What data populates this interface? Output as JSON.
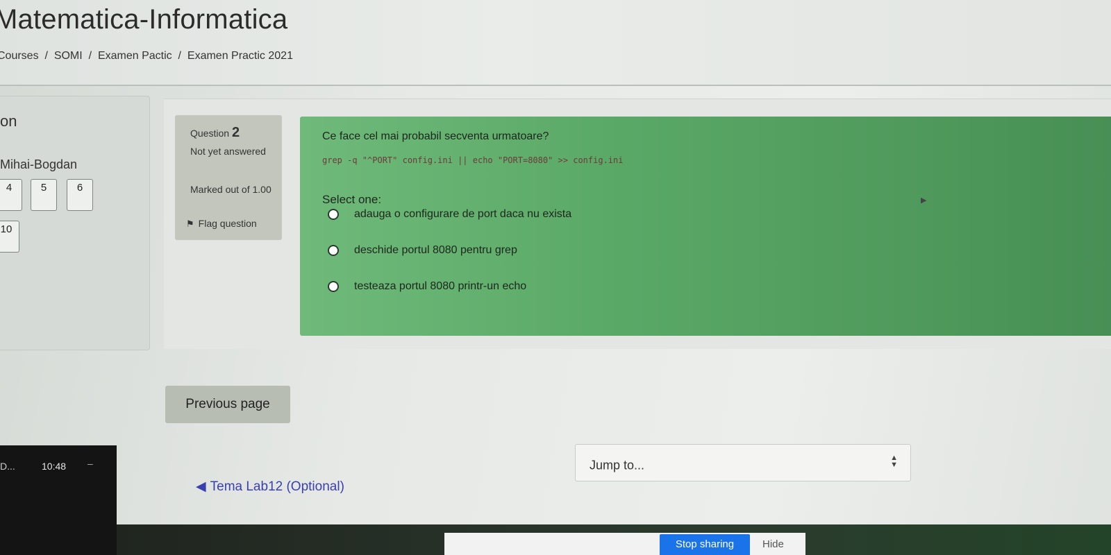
{
  "header": {
    "site_title": "Matematica-Informatica",
    "breadcrumb": [
      "Courses",
      "SOMI",
      "Examen Pactic",
      "Examen Practic 2021"
    ],
    "separator": "/"
  },
  "quiz_nav": {
    "heading": "on",
    "user": "Mihai-Bogdan",
    "buttons": [
      "4",
      "5",
      "6",
      "10"
    ]
  },
  "question_info": {
    "label": "Question",
    "number": "2",
    "state": "Not yet answered",
    "marks": "Marked out of 1.00",
    "flag_label": "Flag question"
  },
  "question": {
    "text": "Ce face cel mai probabil secventa urmatoare?",
    "code": "grep -q \"^PORT\" config.ini || echo \"PORT=8080\" >> config.ini",
    "select_label": "Select one:",
    "options": [
      "adauga o configurare de port daca nu exista",
      "deschide portul 8080 pentru grep",
      "testeaza portul 8080 printr-un echo"
    ]
  },
  "navigation": {
    "previous_page": "Previous page",
    "prev_activity": "Tema Lab12 (Optional)",
    "jump_to": "Jump to..."
  },
  "taskbar": {
    "app": "D...",
    "time": "10:48",
    "dash": "–"
  },
  "screen_share": {
    "stop_label": "Stop sharing",
    "hide_label": "Hide",
    "accent": "#1a73e8"
  },
  "colors": {
    "question_bg": "#5aa866",
    "link": "#3a3fae"
  }
}
